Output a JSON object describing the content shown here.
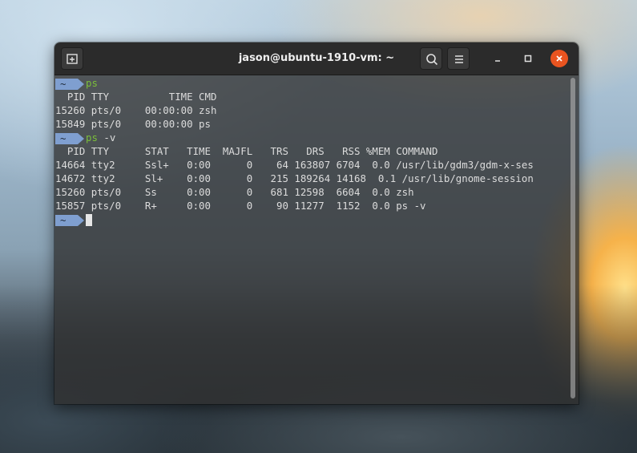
{
  "window": {
    "title": "jason@ubuntu-1910-vm: ~"
  },
  "icons": {
    "new_tab": "new-tab-icon",
    "search": "search-icon",
    "menu": "hamburger-menu-icon",
    "minimize": "minimize-icon",
    "maximize": "maximize-icon",
    "close": "close-icon"
  },
  "colors": {
    "prompt_bg": "#7f9fd0",
    "command_text": "#7bbf3a",
    "close_button": "#e95420"
  },
  "terminal": {
    "prompt_symbol": "~",
    "block1": {
      "command": "ps",
      "args": "",
      "header": "  PID TTY          TIME CMD",
      "rows": [
        "15260 pts/0    00:00:00 zsh",
        "15849 pts/0    00:00:00 ps"
      ]
    },
    "block2": {
      "command": "ps",
      "args": " -v",
      "header": "  PID TTY      STAT   TIME  MAJFL   TRS   DRS   RSS %MEM COMMAND",
      "rows": [
        "14664 tty2     Ssl+   0:00      0    64 163807 6704  0.0 /usr/lib/gdm3/gdm-x-ses",
        "14672 tty2     Sl+    0:00      0   215 189264 14168  0.1 /usr/lib/gnome-session",
        "15260 pts/0    Ss     0:00      0   681 12598  6604  0.0 zsh",
        "15857 pts/0    R+     0:00      0    90 11277  1152  0.0 ps -v"
      ]
    }
  }
}
